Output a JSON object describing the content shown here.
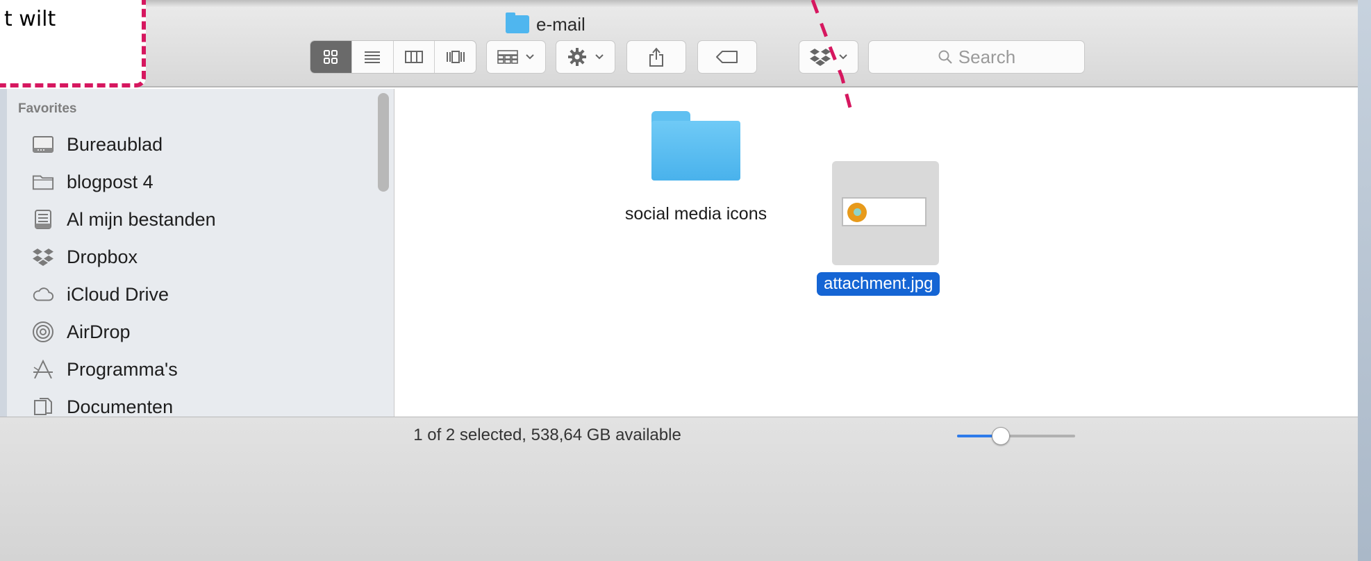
{
  "callout": {
    "text": "t wilt"
  },
  "window": {
    "title": "e-mail"
  },
  "toolbar": {
    "view_modes": [
      {
        "icon": "icon-view-icon",
        "active": true
      },
      {
        "icon": "list-view-icon",
        "active": false
      },
      {
        "icon": "column-view-icon",
        "active": false
      },
      {
        "icon": "cover-flow-icon",
        "active": false
      }
    ],
    "search_placeholder": "Search"
  },
  "sidebar": {
    "heading": "Favorites",
    "items": [
      {
        "label": "Bureaublad",
        "icon": "desktop-icon"
      },
      {
        "label": "blogpost 4",
        "icon": "folder-icon"
      },
      {
        "label": "Al mijn bestanden",
        "icon": "all-files-icon"
      },
      {
        "label": "Dropbox",
        "icon": "dropbox-icon"
      },
      {
        "label": "iCloud Drive",
        "icon": "cloud-icon"
      },
      {
        "label": "AirDrop",
        "icon": "airdrop-icon"
      },
      {
        "label": "Programma's",
        "icon": "applications-icon"
      },
      {
        "label": "Documenten",
        "icon": "documents-icon"
      }
    ]
  },
  "content": {
    "items": [
      {
        "name": "social media icons",
        "kind": "folder",
        "selected": false
      },
      {
        "name": "attachment.jpg",
        "kind": "image",
        "selected": true
      }
    ]
  },
  "status": {
    "text": "1 of 2 selected, 538,64 GB available",
    "icon_size_fraction": 0.35
  },
  "colors": {
    "accent": "#1565d4",
    "folder": "#4fb6ef",
    "callout_border": "#d6175f"
  }
}
